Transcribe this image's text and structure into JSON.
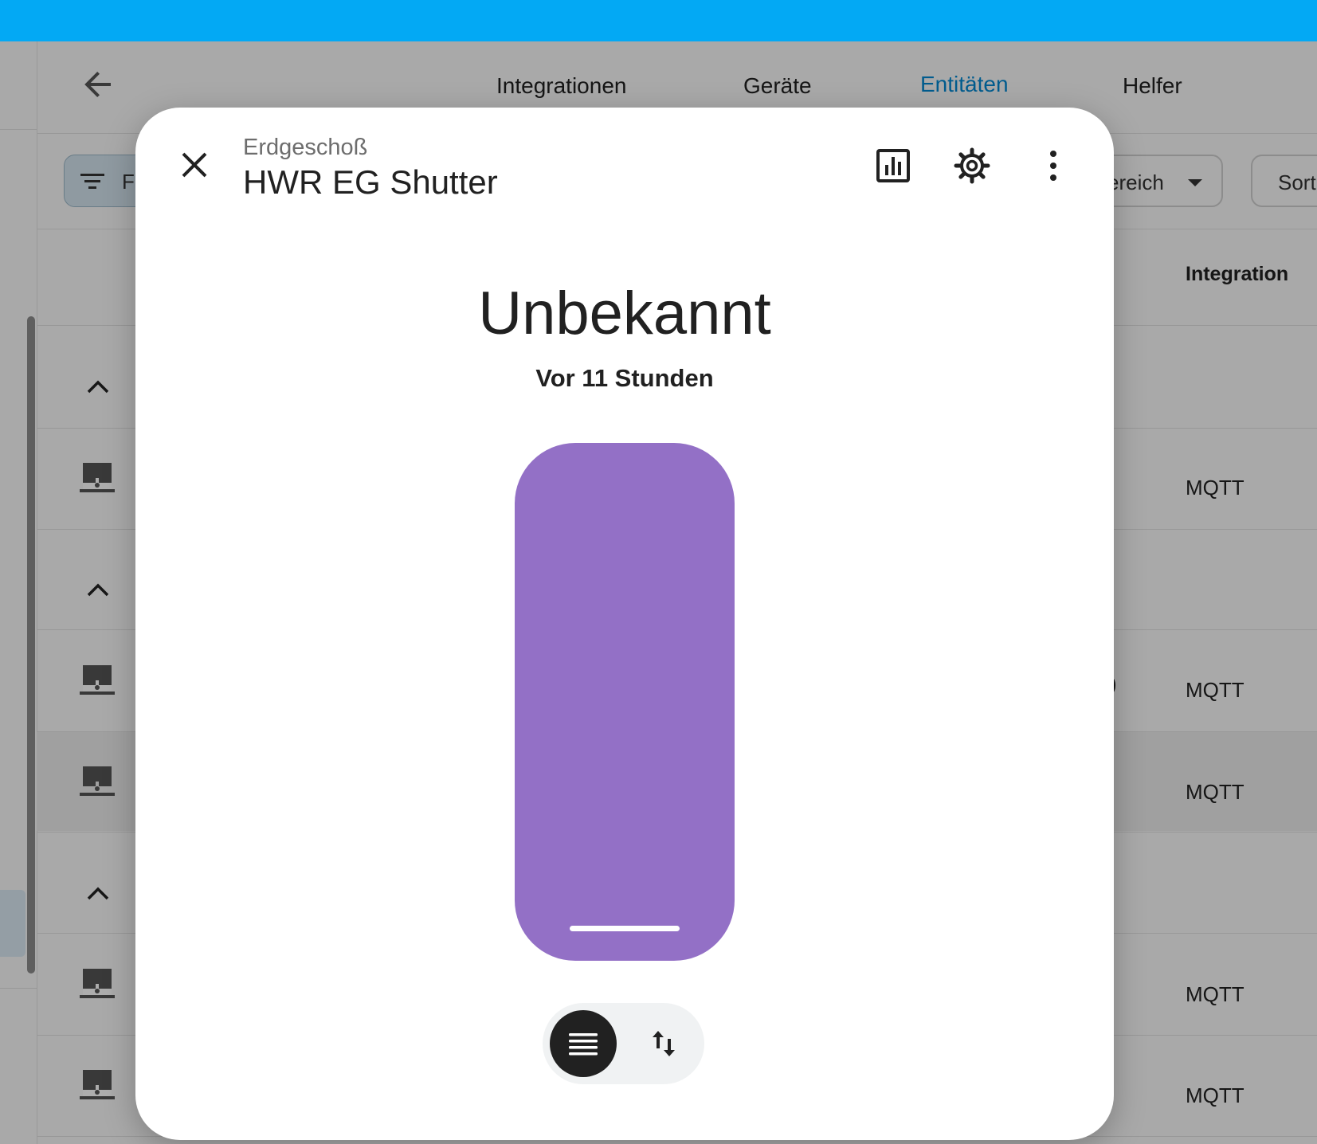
{
  "header": {
    "color": "#03a9f4"
  },
  "tabs": [
    {
      "label": "Integrationen",
      "active": false
    },
    {
      "label": "Geräte",
      "active": false
    },
    {
      "label": "Entitäten",
      "active": true
    },
    {
      "label": "Helfer",
      "active": false
    }
  ],
  "filters": {
    "filter_label": "F",
    "area_label": "ereich",
    "sort_label": "Sort"
  },
  "table": {
    "column_integration": "Integration",
    "rows": [
      {
        "integration": "MQTT"
      },
      {
        "integration": "MQTT"
      },
      {
        "integration": "MQTT"
      },
      {
        "integration": "MQTT"
      },
      {
        "integration": "MQTT"
      }
    ],
    "stray_text": ")"
  },
  "dialog": {
    "subtitle": "Erdgeschoß",
    "title": "HWR EG Shutter",
    "state": "Unbekannt",
    "last_changed": "Vor 11 Stunden",
    "slider_color": "#9370c6",
    "mode_options": [
      "buttons-mode",
      "position-mode"
    ],
    "active_mode": "buttons-mode"
  }
}
